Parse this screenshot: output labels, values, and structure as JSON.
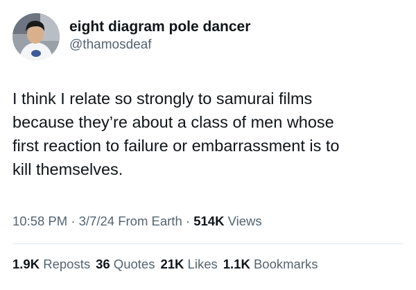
{
  "user": {
    "display_name": "eight diagram pole dancer",
    "handle": "@thamosdeaf"
  },
  "tweet": {
    "text_lines": [
      "I think I relate so strongly to samurai films",
      "because they’re about a class of men whose",
      "first reaction to failure or embarrassment is to",
      "kill themselves."
    ]
  },
  "meta": {
    "time": "10:58 PM",
    "sep1": " · ",
    "date": "3/7/24",
    "location": " From Earth",
    "sep2": " · ",
    "views_count": "514K",
    "views_label": " Views"
  },
  "stats": {
    "reposts_count": "1.9K",
    "reposts_label": " Reposts",
    "quotes_count": "36",
    "quotes_label": " Quotes",
    "likes_count": "21K",
    "likes_label": " Likes",
    "bookmarks_count": "1.1K",
    "bookmarks_label": " Bookmarks"
  },
  "colors": {
    "primary_text": "#0f1419",
    "secondary_text": "#536471",
    "divider": "#e1e6ea",
    "background": "#ffffff"
  }
}
